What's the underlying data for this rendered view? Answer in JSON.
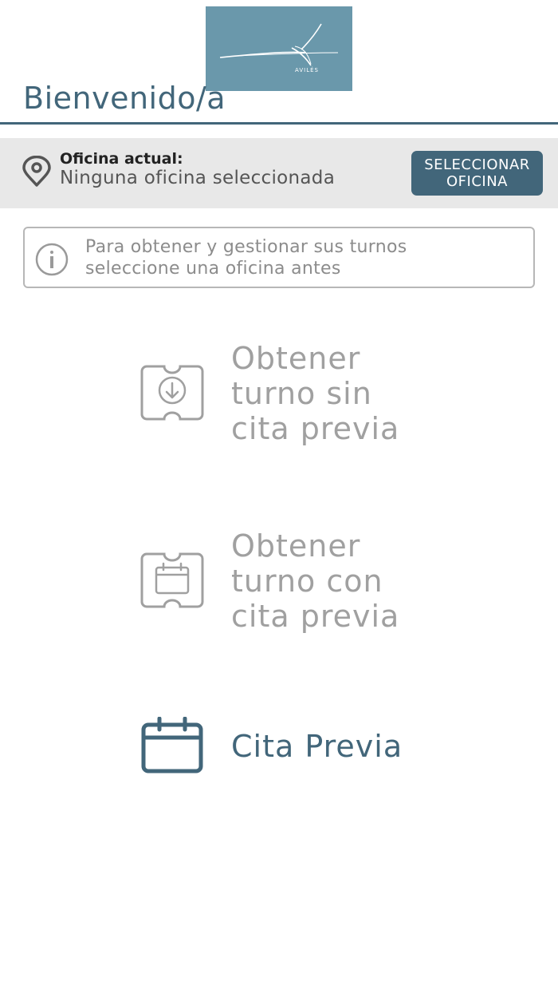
{
  "header": {
    "logo_text": "AVILÉS",
    "welcome": "Bienvenido/a"
  },
  "office": {
    "label": "Oficina actual:",
    "value": "Ninguna oficina seleccionada",
    "select_button": [
      "SELECCIONAR",
      "OFICINA"
    ]
  },
  "info": {
    "lines": [
      "Para obtener y gestionar sus turnos",
      "seleccione una oficina antes"
    ]
  },
  "actions": [
    {
      "lines": [
        "Obtener",
        "turno sin",
        "cita previa"
      ],
      "icon": "ticket-download-icon",
      "enabled": false
    },
    {
      "lines": [
        "Obtener",
        "turno con",
        "cita previa"
      ],
      "icon": "ticket-calendar-icon",
      "enabled": false
    },
    {
      "lines": [
        "Cita Previa"
      ],
      "icon": "calendar-icon",
      "enabled": true
    }
  ],
  "colors": {
    "primary": "#42667a",
    "logo_bg": "#6a98ab",
    "disabled": "#a0a0a0",
    "bar_bg": "#e8e8e8"
  }
}
